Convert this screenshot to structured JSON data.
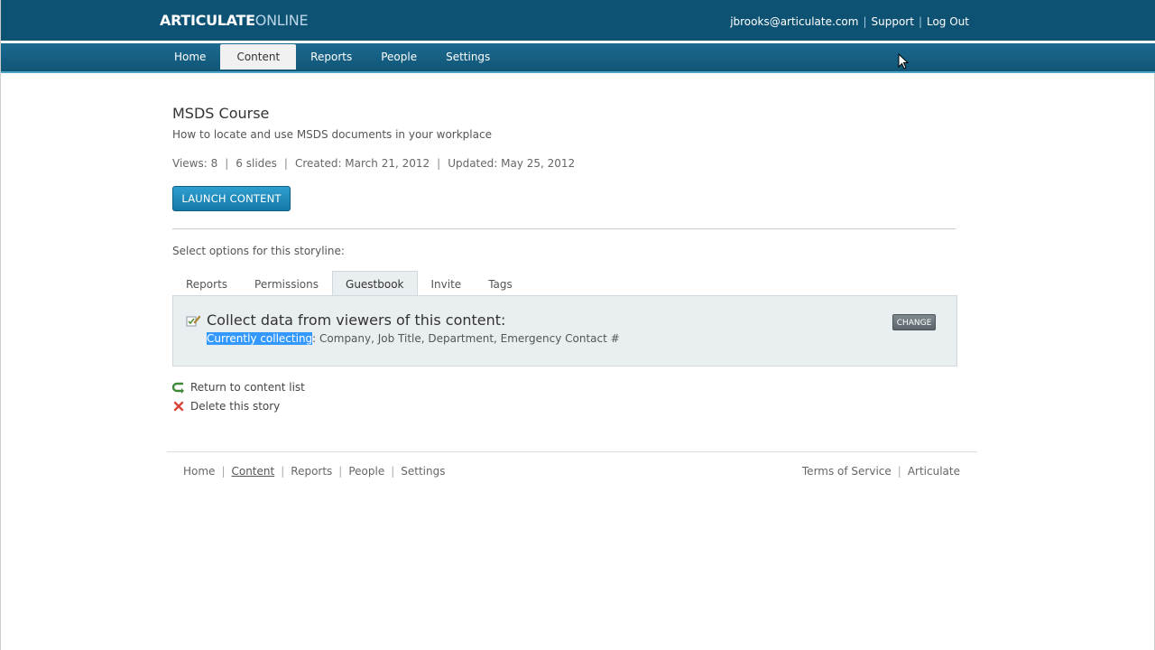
{
  "header": {
    "logo_primary": "ARTICULATE",
    "logo_secondary": "ONLINE",
    "user_email": "jbrooks@articulate.com",
    "support_label": "Support",
    "logout_label": "Log Out",
    "separator": "|"
  },
  "nav": {
    "tabs": [
      {
        "label": "Home"
      },
      {
        "label": "Content"
      },
      {
        "label": "Reports"
      },
      {
        "label": "People"
      },
      {
        "label": "Settings"
      }
    ]
  },
  "content": {
    "title": "MSDS Course",
    "description": "How to locate and use MSDS documents in your workplace",
    "meta": {
      "views": "Views: 8",
      "slides": "6 slides",
      "created": "Created: March 21, 2012",
      "updated": "Updated: May 25, 2012",
      "separator": "|"
    },
    "launch_label": "LAUNCH CONTENT",
    "options_label": "Select options for this storyline:"
  },
  "subtabs": [
    {
      "label": "Reports"
    },
    {
      "label": "Permissions"
    },
    {
      "label": "Guestbook"
    },
    {
      "label": "Invite"
    },
    {
      "label": "Tags"
    }
  ],
  "guestbook": {
    "heading": "Collect data from viewers of this content:",
    "collecting_label": "Currently collecting",
    "collecting_fields": ": Company, Job Title, Department, Emergency Contact #",
    "change_label": "CHANGE"
  },
  "actions": {
    "return_label": "Return to content list",
    "delete_label": "Delete this story"
  },
  "footer": {
    "left_links": [
      {
        "label": "Home"
      },
      {
        "label": "Content"
      },
      {
        "label": "Reports"
      },
      {
        "label": "People"
      },
      {
        "label": "Settings"
      }
    ],
    "terms_label": "Terms of Service",
    "articulate_label": "Articulate",
    "separator": "|"
  },
  "colors": {
    "header_bg": "#0e5273",
    "accent": "#1479a7",
    "panel_bg": "#e9eef0",
    "selection": "#3399ff"
  }
}
